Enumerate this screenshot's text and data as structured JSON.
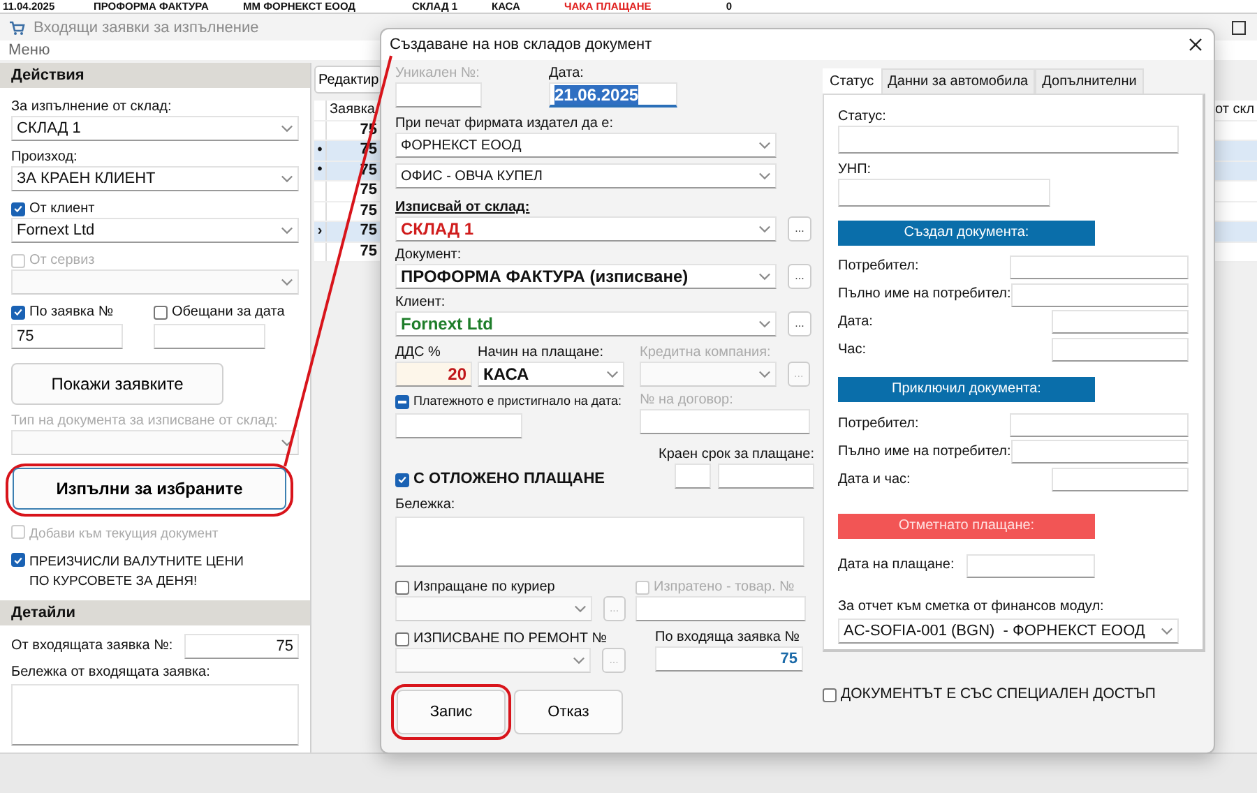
{
  "background_row": {
    "cells": [
      {
        "text": "11.04.2025",
        "kind": "date"
      },
      {
        "text": "ПРОФОРМА ФАКТУРА",
        "kind": "text"
      },
      {
        "text": "ММ ФОРНЕКСТ ЕООД",
        "kind": "text"
      },
      {
        "text": "СКЛАД 1",
        "kind": "text"
      },
      {
        "text": "КАСА",
        "kind": "text"
      },
      {
        "text": "ЧАКА ПЛАЩАНЕ",
        "kind": "status"
      },
      {
        "text": "0",
        "kind": "number"
      }
    ]
  },
  "window": {
    "title": "Входящи заявки за изпълнение"
  },
  "menu": [
    "Меню"
  ],
  "actions": {
    "title": "Действия",
    "items": [
      {
        "kind": "combo",
        "label": "За изпълнение от склад:",
        "value": "СКЛАД 1",
        "disabled": false
      },
      {
        "kind": "combo",
        "label": "Произход:",
        "value": "ЗА КРАЕН КЛИЕНТ",
        "disabled": false
      },
      {
        "kind": "check_combo",
        "label": "От клиент",
        "checked": true,
        "value": "Fornext Ltd",
        "disabled": false
      },
      {
        "kind": "check_combo",
        "label": "От сервиз",
        "checked": false,
        "disabled": true
      },
      {
        "kind": "check_pair",
        "items": [
          {
            "label": "По заявка №",
            "checked": true,
            "value": "75"
          },
          {
            "label": "Обещани за дата",
            "checked": false
          }
        ]
      },
      {
        "kind": "button",
        "label": "Покажи заявките",
        "highlighted": false
      },
      {
        "kind": "combo",
        "label": "Тип на документа за изписване от склад:",
        "disabled": true
      },
      {
        "kind": "button",
        "label": "Изпълни за избраните",
        "highlighted": true
      },
      {
        "kind": "check",
        "label": "Добави към текущия документ",
        "checked": false,
        "disabled": true
      },
      {
        "kind": "check",
        "label": "ПРЕИЗЧИСЛИ ВАЛУТНИТЕ ЦЕНИ\nПО КУРСОВЕТЕ ЗА ДЕНЯ!",
        "checked": true,
        "disabled": false
      }
    ]
  },
  "details": {
    "title": "Детайли",
    "items": [
      {
        "kind": "number",
        "label": "От входящата заявка №:",
        "value": "75"
      },
      {
        "kind": "memo",
        "label": "Бележка от входящата заявка:"
      }
    ]
  },
  "orders_grid": {
    "edit_button": "Редактир",
    "columns": [
      "Заявка",
      "от скл"
    ],
    "rows": [
      {
        "value": "75",
        "selected": false
      },
      {
        "value": "75",
        "selected": true,
        "marker": "•"
      },
      {
        "value": "75",
        "selected": true,
        "marker": "•"
      },
      {
        "value": "75",
        "selected": false
      },
      {
        "value": "75",
        "selected": false
      },
      {
        "value": "75",
        "selected": true,
        "marker": "›"
      },
      {
        "value": "75",
        "selected": false
      }
    ]
  },
  "dialog": {
    "title": "Създаване на нов складов документ",
    "unique_no": {
      "label": "Уникален №:",
      "disabled": true
    },
    "date": {
      "label": "Дата:",
      "value": "21.06.2025"
    },
    "issuer": {
      "label": "При печат фирмата издател да е:",
      "company": "ФОРНЕКСТ ЕООД",
      "office": "ОФИС - ОВЧА КУПЕЛ"
    },
    "selectors": [
      {
        "kind": "warehouse",
        "label": "Изписвай от склад:",
        "value": "СКЛАД 1",
        "browse": "..."
      },
      {
        "kind": "document",
        "label": "Документ:",
        "value": "ПРОФОРМА ФАКТУРА (изписване)",
        "browse": "..."
      },
      {
        "kind": "client",
        "label": "Клиент:",
        "value": "Fornext Ltd",
        "browse": "..."
      }
    ],
    "vat": {
      "label": "ДДС %",
      "value": "20"
    },
    "payment_method": {
      "label": "Начин на плащане:",
      "value": "КАСА"
    },
    "credit_company": {
      "label": "Кредитна компания:",
      "disabled": true,
      "browse": "..."
    },
    "payment_arrived": {
      "label": "Платежното е пристигнало на дата:",
      "indeterminate": true
    },
    "contract": {
      "label": "№ на договор:"
    },
    "deadline": {
      "label": "Краен срок за плащане:"
    },
    "deferred": {
      "label": "С ОТЛОЖЕНО ПЛАЩАНЕ",
      "checked": true
    },
    "note": {
      "label": "Бележка:"
    },
    "courier": {
      "label": "Изпращане по куриер",
      "checked": false,
      "browse": "..."
    },
    "shipped": {
      "label": "Изпратено - товар. №",
      "checked": false,
      "disabled": true
    },
    "repair": {
      "label": "ИЗПИСВАНЕ ПО РЕМОНТ №",
      "checked": false,
      "browse": "..."
    },
    "incoming_order": {
      "label": "По входяща заявка №",
      "value": "75"
    },
    "buttons": [
      {
        "label": "Запис",
        "highlighted": true
      },
      {
        "label": "Отказ",
        "highlighted": false
      }
    ],
    "tabs": [
      {
        "label": "Статус",
        "selected": true
      },
      {
        "label": "Данни за автомобила",
        "selected": false
      },
      {
        "label": "Допълнителни",
        "selected": false
      }
    ],
    "status_items": [
      {
        "kind": "field",
        "label": "Статус:"
      },
      {
        "kind": "short_field",
        "label": "УНП:"
      },
      {
        "kind": "banner",
        "label": "Създал документа:",
        "color": "#0a6eaa"
      },
      {
        "kind": "row_wide",
        "label": "Потребител:"
      },
      {
        "kind": "row_wide",
        "label": "Пълно име на потребител:"
      },
      {
        "kind": "row_narrow",
        "label": "Дата:"
      },
      {
        "kind": "row_narrow",
        "label": "Час:"
      },
      {
        "kind": "banner",
        "label": "Приключил документа:",
        "color": "#0a6eaa"
      },
      {
        "kind": "row_wide",
        "label": "Потребител:"
      },
      {
        "kind": "row_wide",
        "label": "Пълно име на потребител:"
      },
      {
        "kind": "row_narrow",
        "label": "Дата и час:"
      },
      {
        "kind": "banner",
        "label": "Отметнато плащане:",
        "color": "#f25555"
      },
      {
        "kind": "row_mid",
        "label": "Дата на плащане:"
      },
      {
        "kind": "select",
        "label": "За отчет към сметка от финансов модул:",
        "value": "AC-SOFIA-001 (BGN)  - ФОРНЕКСТ ЕООД"
      }
    ],
    "special_access": {
      "label": "ДОКУМЕНТЪТ Е СЪС СПЕЦИАЛЕН ДОСТЪП",
      "checked": false
    }
  },
  "annotation": {
    "connector": true
  }
}
